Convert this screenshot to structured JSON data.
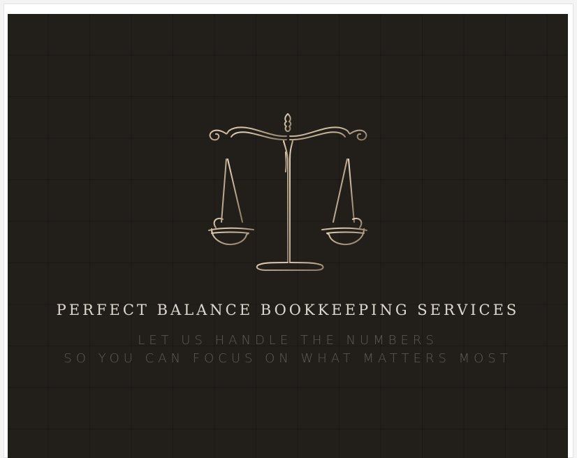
{
  "brand": {
    "title": "PERFECT BALANCE BOOKKEEPING SERVICES",
    "tagline_line1": "LET US HANDLE THE NUMBERS",
    "tagline_line2": "SO YOU CAN FOCUS ON WHAT MATTERS MOST",
    "logo_icon": "scales-of-justice-icon"
  },
  "colors": {
    "background": "#221f1b",
    "title": "#ddd8cf",
    "tagline": "#5f5a54",
    "logo_gold_light": "#e3d2b8",
    "logo_gold_dark": "#8a7a66"
  }
}
